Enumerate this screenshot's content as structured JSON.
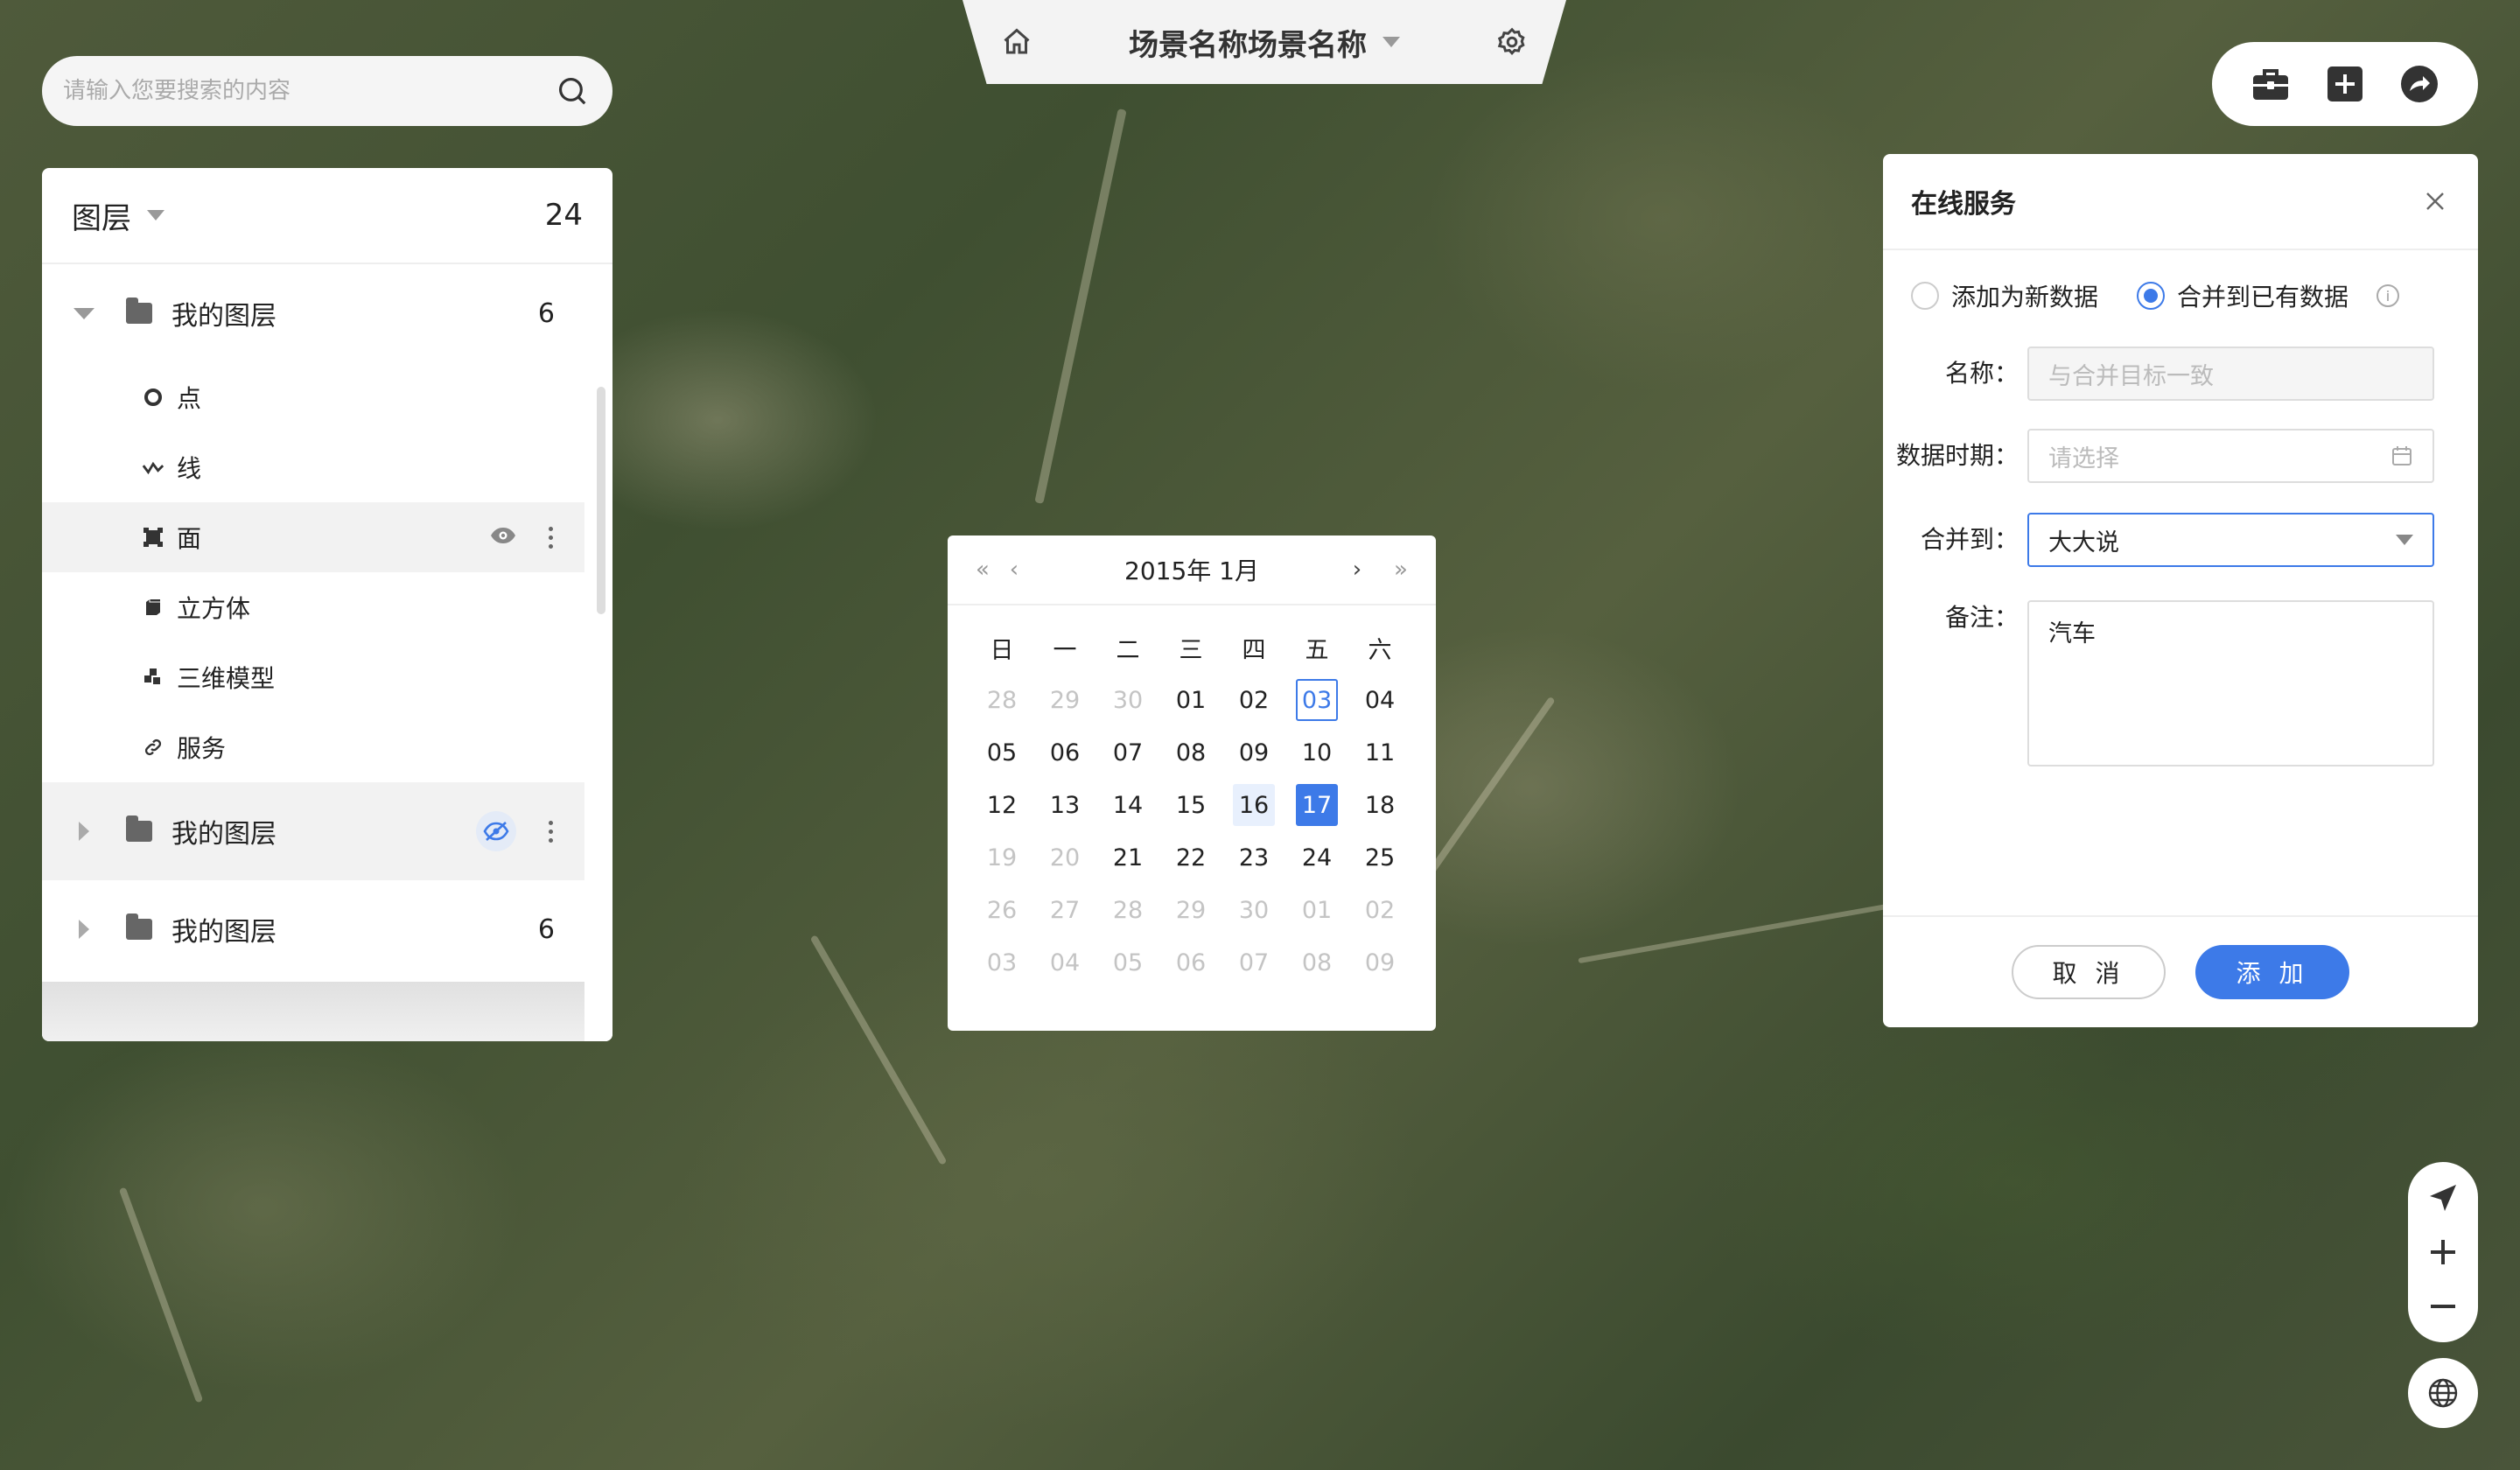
{
  "app": {
    "scene_title": "场景名称场景名称"
  },
  "search": {
    "placeholder": "请输入您要搜索的内容"
  },
  "layers": {
    "title": "图层",
    "total": "24",
    "groups": [
      {
        "label": "我的图层",
        "count": "6",
        "expanded": true,
        "children": [
          {
            "label": "点",
            "icon": "point-icon"
          },
          {
            "label": "线",
            "icon": "line-icon"
          },
          {
            "label": "面",
            "icon": "polygon-icon"
          },
          {
            "label": "立方体",
            "icon": "cube-icon"
          },
          {
            "label": "三维模型",
            "icon": "model-icon"
          },
          {
            "label": "服务",
            "icon": "link-icon"
          }
        ]
      },
      {
        "label": "我的图层",
        "count": "",
        "expanded": false
      },
      {
        "label": "我的图层",
        "count": "6",
        "expanded": false
      }
    ]
  },
  "calendar": {
    "title": "2015年 1月",
    "weekdays": [
      "日",
      "一",
      "二",
      "三",
      "四",
      "五",
      "六"
    ],
    "days": [
      [
        "28",
        "29",
        "30",
        "01",
        "02",
        "03",
        "04"
      ],
      [
        "05",
        "06",
        "07",
        "08",
        "09",
        "10",
        "11"
      ],
      [
        "12",
        "13",
        "14",
        "15",
        "16",
        "17",
        "18"
      ],
      [
        "19",
        "20",
        "21",
        "22",
        "23",
        "24",
        "25"
      ],
      [
        "26",
        "27",
        "28",
        "29",
        "30",
        "01",
        "02"
      ],
      [
        "03",
        "04",
        "05",
        "06",
        "07",
        "08",
        "09"
      ]
    ],
    "today": "03",
    "selected": "17",
    "hovered": "16"
  },
  "dialog": {
    "title": "在线服务",
    "radio_new": "添加为新数据",
    "radio_merge": "合并到已有数据",
    "name_label": "名称：",
    "name_value": "与合并目标一致",
    "period_label": "数据时期：",
    "period_placeholder": "请选择",
    "merge_label": "合并到：",
    "merge_value": "大大说",
    "note_label": "备注：",
    "note_value": "汽车",
    "cancel_label": "取 消",
    "add_label": "添 加"
  },
  "colors": {
    "accent": "#3d7ae8"
  }
}
